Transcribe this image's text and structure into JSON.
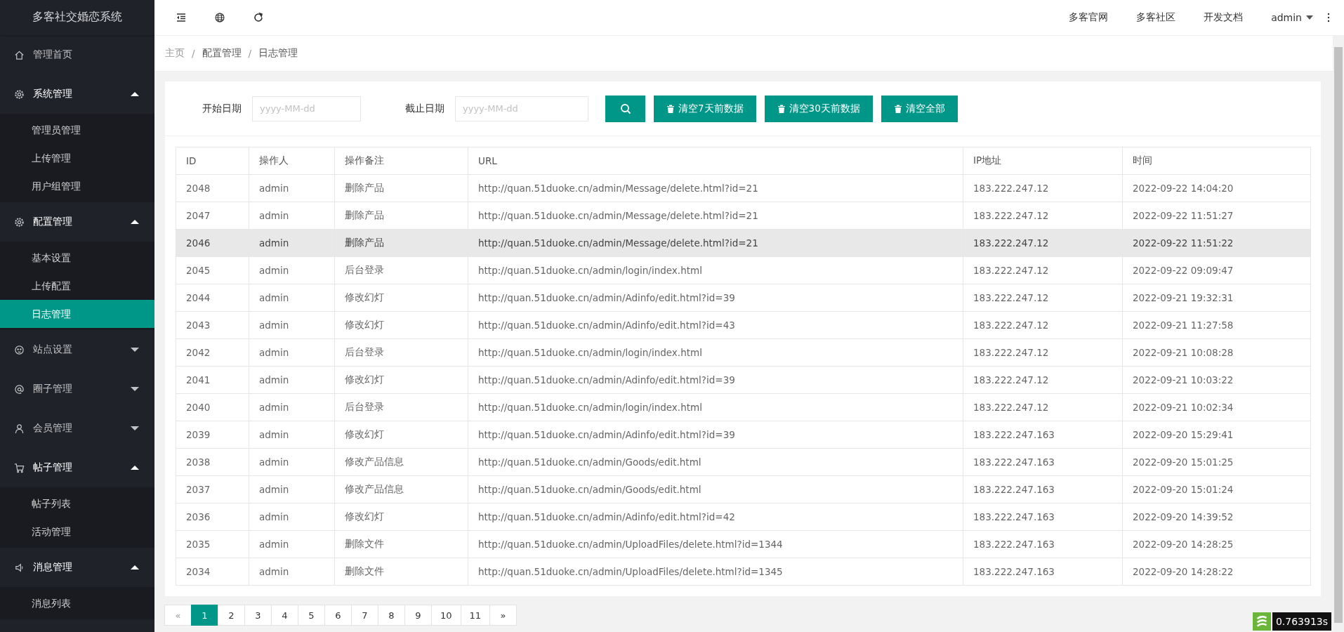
{
  "app_title": "多客社交婚恋系统",
  "sidebar": {
    "items": [
      {
        "label": "管理首页",
        "kind": "link",
        "selected": false
      },
      {
        "label": "系统管理",
        "kind": "menu",
        "expanded": true,
        "selected": false,
        "children": [
          {
            "label": "管理员管理",
            "selected": false
          },
          {
            "label": "上传管理",
            "selected": false
          },
          {
            "label": "用户组管理",
            "selected": false
          }
        ]
      },
      {
        "label": "配置管理",
        "kind": "menu",
        "expanded": true,
        "selected": false,
        "children": [
          {
            "label": "基本设置",
            "selected": false
          },
          {
            "label": "上传配置",
            "selected": false
          },
          {
            "label": "日志管理",
            "selected": true
          }
        ]
      },
      {
        "label": "站点设置",
        "kind": "menu",
        "expanded": false,
        "selected": false
      },
      {
        "label": "圈子管理",
        "kind": "menu",
        "expanded": false,
        "selected": false
      },
      {
        "label": "会员管理",
        "kind": "menu",
        "expanded": false,
        "selected": false
      },
      {
        "label": "帖子管理",
        "kind": "menu",
        "expanded": true,
        "selected": false,
        "children": [
          {
            "label": "帖子列表",
            "selected": false
          },
          {
            "label": "活动管理",
            "selected": false
          }
        ]
      },
      {
        "label": "消息管理",
        "kind": "menu",
        "expanded": true,
        "selected": false,
        "children": [
          {
            "label": "消息列表",
            "selected": false
          }
        ]
      }
    ]
  },
  "top_links": [
    "多客官网",
    "多客社区",
    "开发文档"
  ],
  "user": "admin",
  "breadcrumb": {
    "items": [
      "主页",
      "配置管理",
      "日志管理"
    ],
    "separator": "/"
  },
  "filter": {
    "start_label": "开始日期",
    "start_placeholder": "yyyy-MM-dd",
    "end_label": "截止日期",
    "end_placeholder": "yyyy-MM-dd",
    "buttons": [
      "清空7天前数据",
      "清空30天前数据",
      "清空全部"
    ]
  },
  "table": {
    "columns": [
      "ID",
      "操作人",
      "操作备注",
      "URL",
      "IP地址",
      "时间"
    ],
    "rows": [
      {
        "cells": [
          "2048",
          "admin",
          "删除产品",
          "http://quan.51duoke.cn/admin/Message/delete.html?id=21",
          "183.222.247.12",
          "2022-09-22 14:04:20"
        ],
        "highlighted": false
      },
      {
        "cells": [
          "2047",
          "admin",
          "删除产品",
          "http://quan.51duoke.cn/admin/Message/delete.html?id=21",
          "183.222.247.12",
          "2022-09-22 11:51:27"
        ],
        "highlighted": false
      },
      {
        "cells": [
          "2046",
          "admin",
          "删除产品",
          "http://quan.51duoke.cn/admin/Message/delete.html?id=21",
          "183.222.247.12",
          "2022-09-22 11:51:22"
        ],
        "highlighted": true
      },
      {
        "cells": [
          "2045",
          "admin",
          "后台登录",
          "http://quan.51duoke.cn/admin/login/index.html",
          "183.222.247.12",
          "2022-09-22 09:09:47"
        ],
        "highlighted": false
      },
      {
        "cells": [
          "2044",
          "admin",
          "修改幻灯",
          "http://quan.51duoke.cn/admin/Adinfo/edit.html?id=39",
          "183.222.247.12",
          "2022-09-21 19:32:31"
        ],
        "highlighted": false
      },
      {
        "cells": [
          "2043",
          "admin",
          "修改幻灯",
          "http://quan.51duoke.cn/admin/Adinfo/edit.html?id=43",
          "183.222.247.12",
          "2022-09-21 11:27:58"
        ],
        "highlighted": false
      },
      {
        "cells": [
          "2042",
          "admin",
          "后台登录",
          "http://quan.51duoke.cn/admin/login/index.html",
          "183.222.247.12",
          "2022-09-21 10:08:28"
        ],
        "highlighted": false
      },
      {
        "cells": [
          "2041",
          "admin",
          "修改幻灯",
          "http://quan.51duoke.cn/admin/Adinfo/edit.html?id=39",
          "183.222.247.12",
          "2022-09-21 10:03:22"
        ],
        "highlighted": false
      },
      {
        "cells": [
          "2040",
          "admin",
          "后台登录",
          "http://quan.51duoke.cn/admin/login/index.html",
          "183.222.247.12",
          "2022-09-21 10:02:34"
        ],
        "highlighted": false
      },
      {
        "cells": [
          "2039",
          "admin",
          "修改幻灯",
          "http://quan.51duoke.cn/admin/Adinfo/edit.html?id=39",
          "183.222.247.163",
          "2022-09-20 15:29:41"
        ],
        "highlighted": false
      },
      {
        "cells": [
          "2038",
          "admin",
          "修改产品信息",
          "http://quan.51duoke.cn/admin/Goods/edit.html",
          "183.222.247.163",
          "2022-09-20 15:01:25"
        ],
        "highlighted": false
      },
      {
        "cells": [
          "2037",
          "admin",
          "修改产品信息",
          "http://quan.51duoke.cn/admin/Goods/edit.html",
          "183.222.247.163",
          "2022-09-20 15:01:24"
        ],
        "highlighted": false
      },
      {
        "cells": [
          "2036",
          "admin",
          "修改幻灯",
          "http://quan.51duoke.cn/admin/Adinfo/edit.html?id=42",
          "183.222.247.163",
          "2022-09-20 14:39:52"
        ],
        "highlighted": false
      },
      {
        "cells": [
          "2035",
          "admin",
          "删除文件",
          "http://quan.51duoke.cn/admin/UploadFiles/delete.html?id=1344",
          "183.222.247.163",
          "2022-09-20 14:28:25"
        ],
        "highlighted": false
      },
      {
        "cells": [
          "2034",
          "admin",
          "删除文件",
          "http://quan.51duoke.cn/admin/UploadFiles/delete.html?id=1345",
          "183.222.247.163",
          "2022-09-20 14:28:22"
        ],
        "highlighted": false
      }
    ]
  },
  "pagination": {
    "prev": "«",
    "next": "»",
    "pages": [
      {
        "label": "1",
        "selected": true
      },
      {
        "label": "2",
        "selected": false
      },
      {
        "label": "3",
        "selected": false
      },
      {
        "label": "4",
        "selected": false
      },
      {
        "label": "5",
        "selected": false
      },
      {
        "label": "6",
        "selected": false
      },
      {
        "label": "7",
        "selected": false
      },
      {
        "label": "8",
        "selected": false
      },
      {
        "label": "9",
        "selected": false
      },
      {
        "label": "10",
        "selected": false
      },
      {
        "label": "11",
        "selected": false
      }
    ]
  },
  "debug_time": "0.763913s"
}
